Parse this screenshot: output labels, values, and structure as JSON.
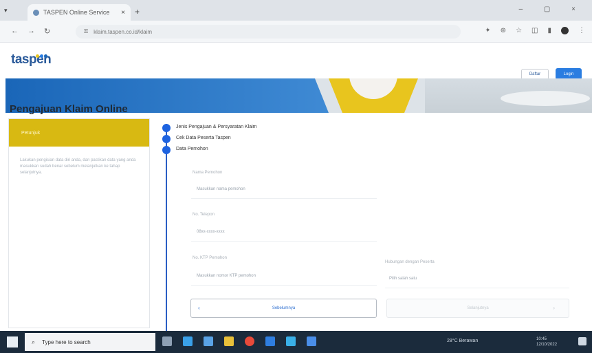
{
  "browser": {
    "tab_title": "TASPEN Online Service",
    "tab_close": "×",
    "new_tab": "+",
    "url": "klaim.taspen.co.id/klaim",
    "window_controls": "– ▢ ×",
    "nav": {
      "back": "←",
      "forward": "→",
      "reload": "↻"
    }
  },
  "site": {
    "logo_text": "taspen",
    "logo_dot_colors": [
      "#e8c51e",
      "#2a7de1",
      "#1a66b8"
    ],
    "daftar_label": "Daftar",
    "login_label": "Login",
    "banner_tagline": "",
    "accent_blue": "#1e63e0",
    "accent_yellow": "#d8b912"
  },
  "page": {
    "title": "Pengajuan Klaim Online"
  },
  "sidebar": {
    "header": "Petunjuk",
    "text": "Lakukan pengisian data diri anda, dan pastikan data yang anda masukkan sudah benar sebelum melanjutkan ke tahap selanjutnya."
  },
  "steps": [
    {
      "label": "Jenis Pengajuan & Persyaratan Klaim"
    },
    {
      "label": "Cek Data Peserta Taspen"
    },
    {
      "label": "Data Pemohon"
    }
  ],
  "form": {
    "fields": [
      {
        "label": "Nama Pemohon",
        "value": "Masukkan nama pemohon"
      },
      {
        "label": "No. Telepon",
        "value": "08xx-xxxx-xxxx"
      },
      {
        "label": "No. KTP Pemohon",
        "value": "Masukkan nomor KTP pemohon"
      },
      {
        "label": "Hubungan dengan Peserta",
        "value": "Pilih salah satu"
      }
    ],
    "back_label": "Sebelumnya",
    "next_label": "Selanjutnya",
    "back_arrow": "‹",
    "next_arrow": "›"
  },
  "taskbar": {
    "search_placeholder": "Type here to search",
    "weather": "28°C Berawan",
    "time": "10:45",
    "date": "12/10/2022"
  }
}
